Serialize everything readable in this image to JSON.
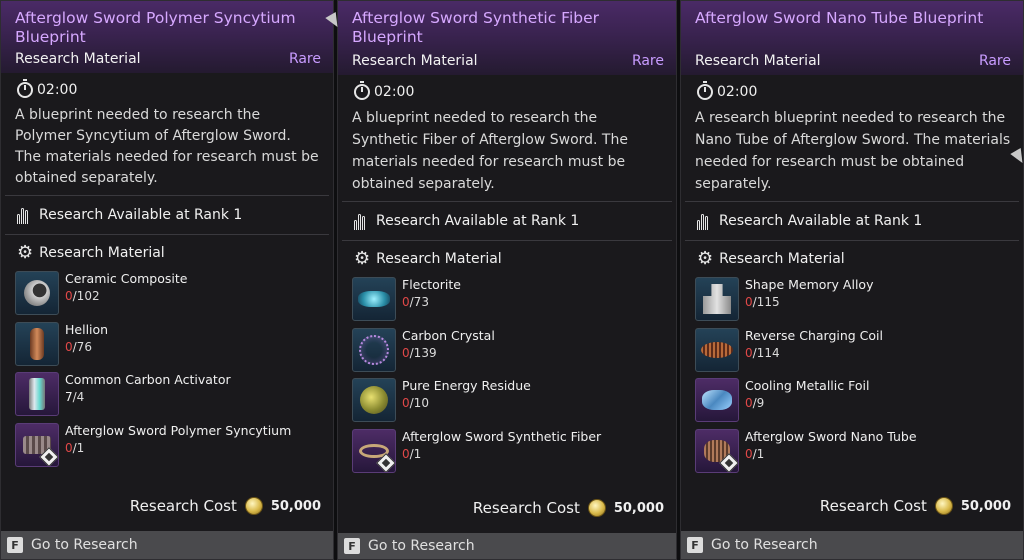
{
  "panels": [
    {
      "title": "Afterglow Sword Polymer Syncytium Blueprint",
      "type": "Research Material",
      "rarity": "Rare",
      "timer": "02:00",
      "description": "A blueprint needed to research the Polymer Syncytium of Afterglow Sword. The materials needed for research must be obtained separately.",
      "rank": "Research Available at Rank 1",
      "materials_heading": "Research Material",
      "materials": [
        {
          "name": "Ceramic Composite",
          "have": "0",
          "need": "/102",
          "enough": false,
          "icon": "ceramic-composite-icon",
          "frame": "blue"
        },
        {
          "name": "Hellion",
          "have": "0",
          "need": "/76",
          "enough": false,
          "icon": "hellion-icon",
          "frame": "blue"
        },
        {
          "name": "Common Carbon Activator",
          "have": "7",
          "need": "/4",
          "enough": true,
          "icon": "carbon-activator-icon",
          "frame": "purple"
        },
        {
          "name": "Afterglow Sword Polymer Syncytium",
          "have": "0",
          "need": "/1",
          "enough": false,
          "icon": "polymer-syncytium-icon",
          "frame": "purple"
        }
      ],
      "cost_label": "Research Cost",
      "cost_value": "50,000",
      "footer_key": "F",
      "footer_label": "Go to Research"
    },
    {
      "title": "Afterglow Sword Synthetic Fiber Blueprint",
      "type": "Research Material",
      "rarity": "Rare",
      "timer": "02:00",
      "description": "A blueprint needed to research the Synthetic Fiber of Afterglow Sword. The materials needed for research must be obtained separately.",
      "rank": "Research Available at Rank 1",
      "materials_heading": "Research Material",
      "materials": [
        {
          "name": "Flectorite",
          "have": "0",
          "need": "/73",
          "enough": false,
          "icon": "flectorite-icon",
          "frame": "blue"
        },
        {
          "name": "Carbon Crystal",
          "have": "0",
          "need": "/139",
          "enough": false,
          "icon": "carbon-crystal-icon",
          "frame": "blue"
        },
        {
          "name": "Pure Energy Residue",
          "have": "0",
          "need": "/10",
          "enough": false,
          "icon": "energy-residue-icon",
          "frame": "blue"
        },
        {
          "name": "Afterglow Sword Synthetic Fiber",
          "have": "0",
          "need": "/1",
          "enough": false,
          "icon": "synthetic-fiber-icon",
          "frame": "purple"
        }
      ],
      "cost_label": "Research Cost",
      "cost_value": "50,000",
      "footer_key": "F",
      "footer_label": "Go to Research"
    },
    {
      "title": "Afterglow Sword Nano Tube Blueprint",
      "type": "Research Material",
      "rarity": "Rare",
      "timer": "02:00",
      "description": "A research blueprint needed to research the Nano Tube of Afterglow Sword. The materials needed for research must be obtained separately.",
      "rank": "Research Available at Rank 1",
      "materials_heading": "Research Material",
      "materials": [
        {
          "name": "Shape Memory Alloy",
          "have": "0",
          "need": "/115",
          "enough": false,
          "icon": "shape-memory-alloy-icon",
          "frame": "blue"
        },
        {
          "name": "Reverse Charging Coil",
          "have": "0",
          "need": "/114",
          "enough": false,
          "icon": "charging-coil-icon",
          "frame": "blue"
        },
        {
          "name": "Cooling Metallic Foil",
          "have": "0",
          "need": "/9",
          "enough": false,
          "icon": "metallic-foil-icon",
          "frame": "purple"
        },
        {
          "name": "Afterglow Sword Nano Tube",
          "have": "0",
          "need": "/1",
          "enough": false,
          "icon": "nano-tube-icon",
          "frame": "purple"
        }
      ],
      "cost_label": "Research Cost",
      "cost_value": "50,000",
      "footer_key": "F",
      "footer_label": "Go to Research"
    }
  ]
}
